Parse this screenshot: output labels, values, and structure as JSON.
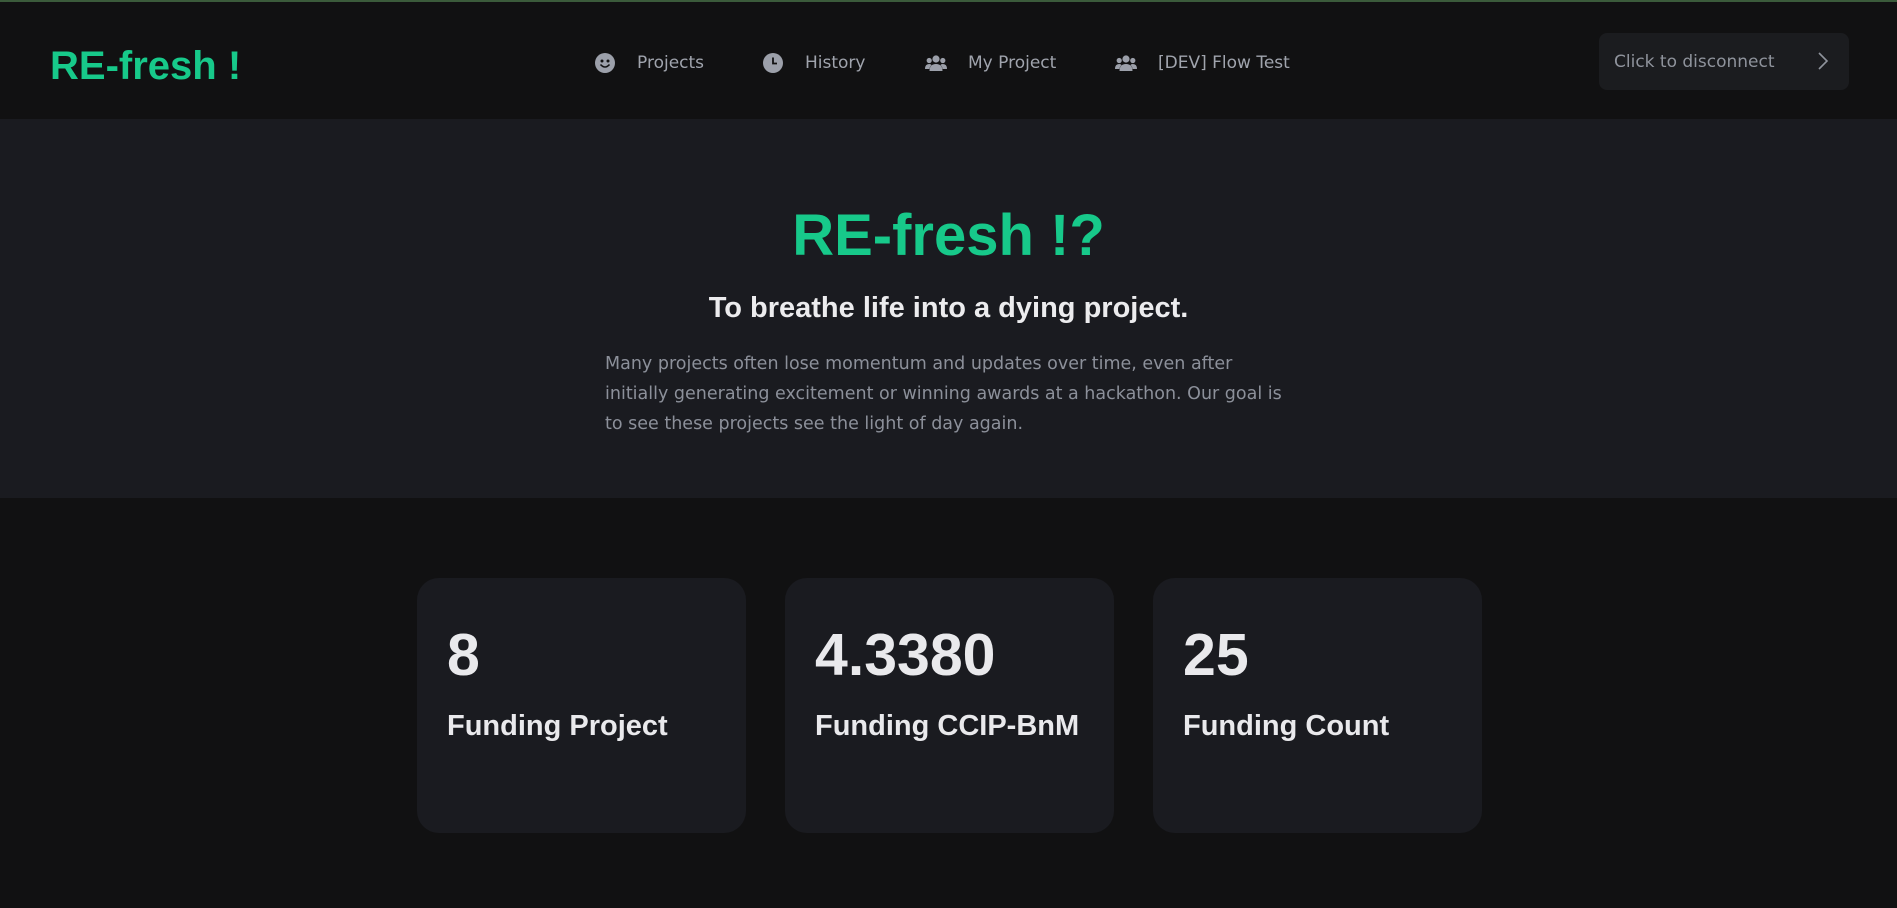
{
  "header": {
    "brand": "RE-fresh !",
    "nav": [
      {
        "label": "Projects",
        "icon": "smiley-icon"
      },
      {
        "label": "History",
        "icon": "clock-icon"
      },
      {
        "label": "My Project",
        "icon": "users-icon"
      },
      {
        "label": "[DEV] Flow Test",
        "icon": "users-icon"
      }
    ],
    "disconnect_label": "Click to disconnect"
  },
  "hero": {
    "title": "RE-fresh !?",
    "subtitle": "To breathe life into a dying project.",
    "description": "Many projects often lose momentum and updates over time, even after initially generating excitement or winning awards at a hackathon. Our goal is to see these projects see the light of day again."
  },
  "stats": [
    {
      "value": "8",
      "label": "Funding Project"
    },
    {
      "value": "4.3380",
      "label": "Funding CCIP-BnM"
    },
    {
      "value": "25",
      "label": "Funding Count"
    }
  ],
  "colors": {
    "accent": "#17c98a",
    "background": "#111112",
    "panel": "#1a1b20"
  }
}
